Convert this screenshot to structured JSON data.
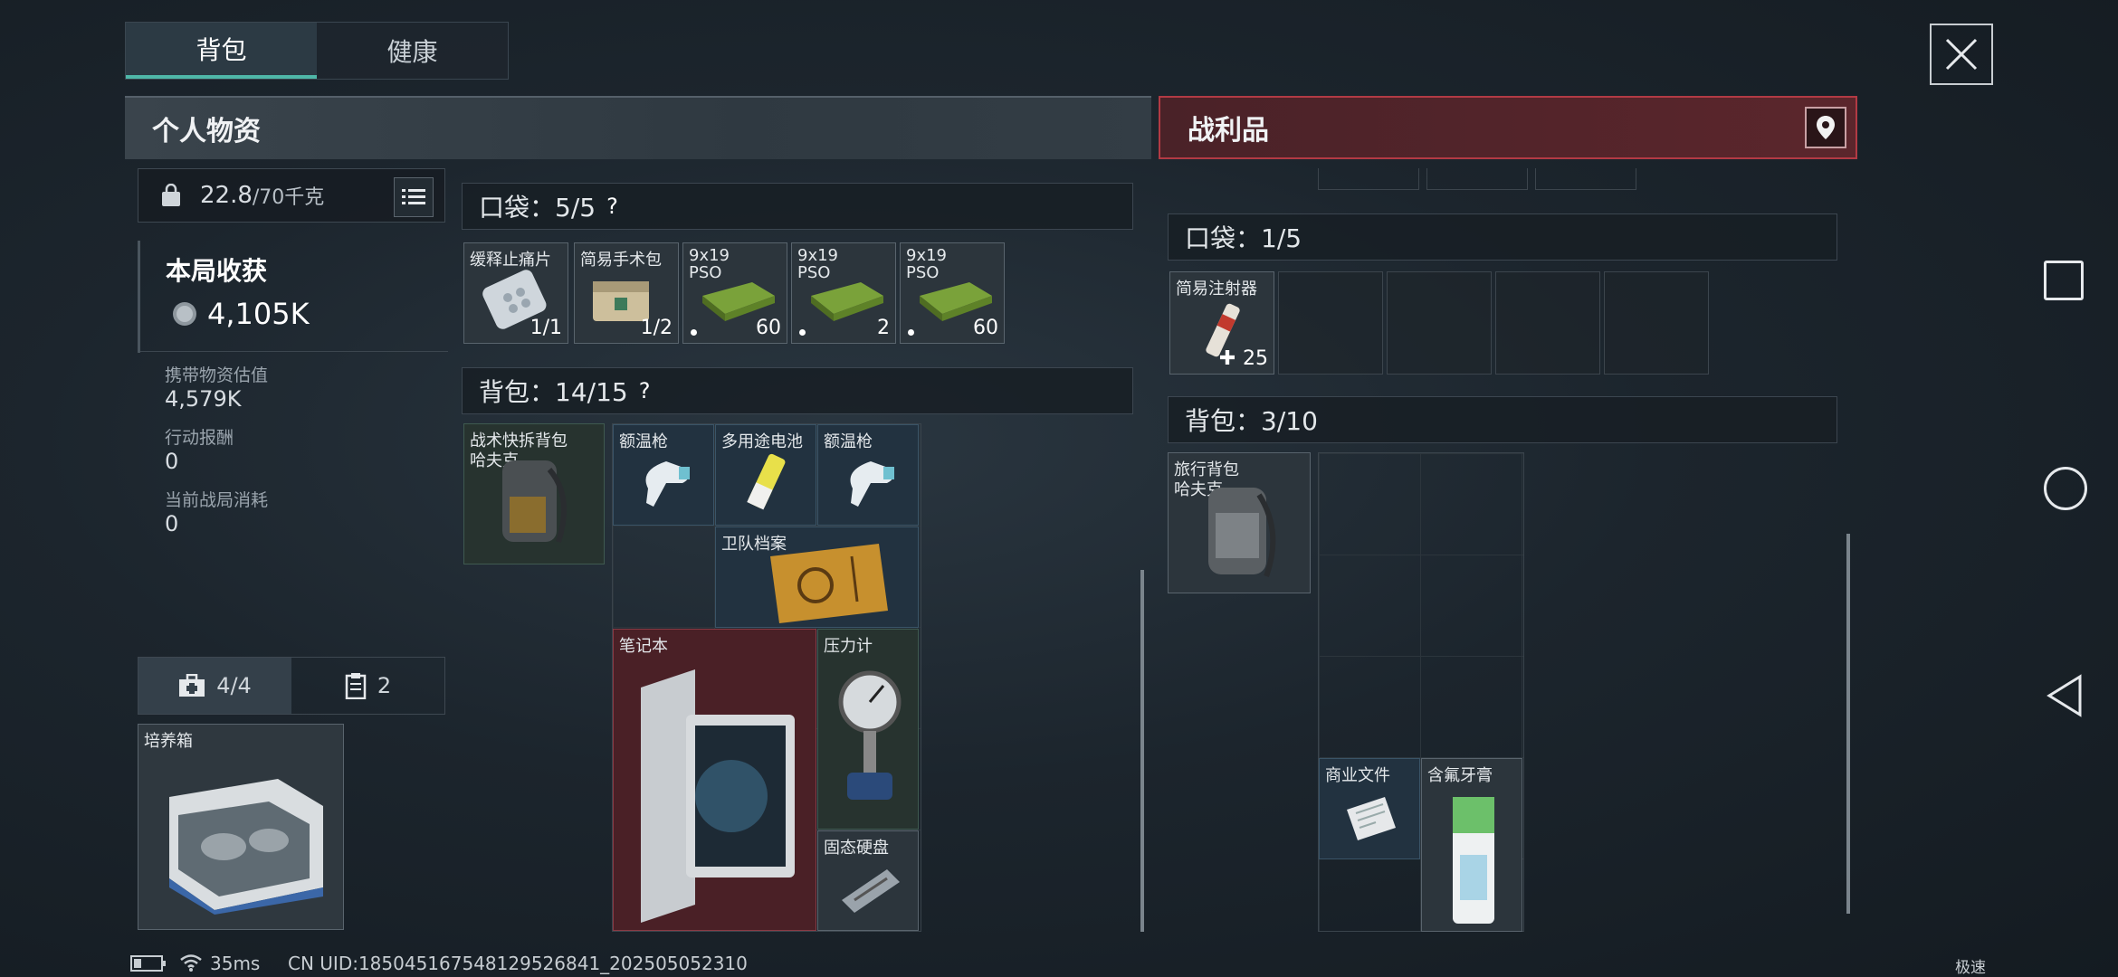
{
  "tabs": [
    {
      "label": "背包"
    },
    {
      "label": "健康"
    }
  ],
  "left_header": "个人物资",
  "right_header": "战利品",
  "weight": {
    "value": "22.8",
    "limit": "/70千克"
  },
  "harvest": {
    "title": "本局收获",
    "value": "4,105K"
  },
  "stats": [
    {
      "label": "携带物资估值",
      "value": "4,579K"
    },
    {
      "label": "行动报酬",
      "value": "0"
    },
    {
      "label": "当前战局消耗",
      "value": "0"
    }
  ],
  "mini_tabs": [
    {
      "label": "4/4",
      "icon": "medkit-icon"
    },
    {
      "label": "2",
      "icon": "clipboard-icon"
    }
  ],
  "safe_box": {
    "name": "培养箱"
  },
  "left_pocket": {
    "label": "口袋：5/5",
    "help": "?",
    "items": [
      {
        "name": "缓释止痛片",
        "qty": "1/1"
      },
      {
        "name": "简易手术包",
        "qty": "1/2"
      },
      {
        "name": "9x19 PSO",
        "qty": "60"
      },
      {
        "name": "9x19 PSO",
        "qty": "2"
      },
      {
        "name": "9x19 PSO",
        "qty": "60"
      }
    ]
  },
  "left_backpack": {
    "label": "背包：14/15",
    "help": "?",
    "bag_name": "战术快拆背包",
    "bag_sub": "哈夫克",
    "items": [
      {
        "name": "额温枪"
      },
      {
        "name": "多用途电池"
      },
      {
        "name": "额温枪"
      },
      {
        "name": "卫队档案"
      },
      {
        "name": "笔记本"
      },
      {
        "name": "压力计"
      },
      {
        "name": "固态硬盘"
      }
    ]
  },
  "right_pocket": {
    "label": "口袋：1/5",
    "items": [
      {
        "name": "简易注射器",
        "qty": "25"
      }
    ]
  },
  "right_backpack": {
    "label": "背包：3/10",
    "bag_name": "旅行背包",
    "bag_sub": "哈夫克",
    "items": [
      {
        "name": "商业文件"
      },
      {
        "name": "含氟牙膏"
      }
    ]
  },
  "status_bar": {
    "ping": "35ms",
    "uid": "CN UID:185045167548129526841_202505052310",
    "mode": "极速"
  },
  "colors": {
    "accent": "#4fb7a8",
    "loot_red": "#b23a44",
    "slot_green": "#27332f",
    "slot_blue": "#223240",
    "slot_red": "#4a2026"
  }
}
